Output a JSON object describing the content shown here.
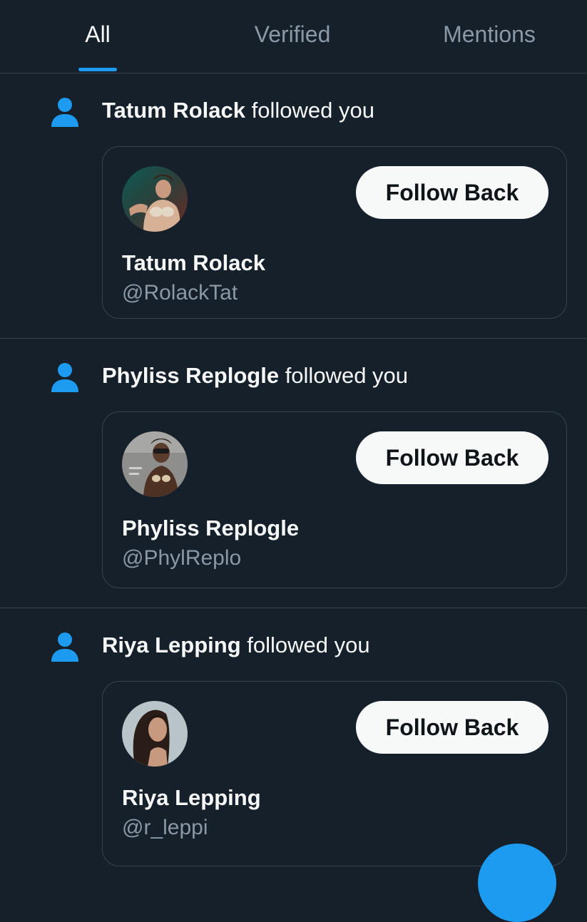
{
  "tabs": [
    {
      "label": "All",
      "active": true
    },
    {
      "label": "Verified",
      "active": false
    },
    {
      "label": "Mentions",
      "active": false
    }
  ],
  "colors": {
    "background": "#15202b",
    "accent": "#1d9bf0",
    "border": "#38444d",
    "text_primary": "#f7f9f9",
    "text_secondary": "#8b98a5"
  },
  "notifications": [
    {
      "icon": "person-icon",
      "name": "Tatum Rolack",
      "action": " followed you",
      "card": {
        "display_name": "Tatum Rolack",
        "handle": "@RolackTat",
        "button_label": "Follow Back"
      }
    },
    {
      "icon": "person-icon",
      "name": "Phyliss Replogle",
      "action": " followed you",
      "card": {
        "display_name": "Phyliss Replogle",
        "handle": "@PhylReplo",
        "button_label": "Follow Back"
      }
    },
    {
      "icon": "person-icon",
      "name": "Riya Lepping",
      "action": " followed you",
      "card": {
        "display_name": "Riya Lepping",
        "handle": "@r_leppi",
        "button_label": "Follow Back"
      }
    }
  ]
}
